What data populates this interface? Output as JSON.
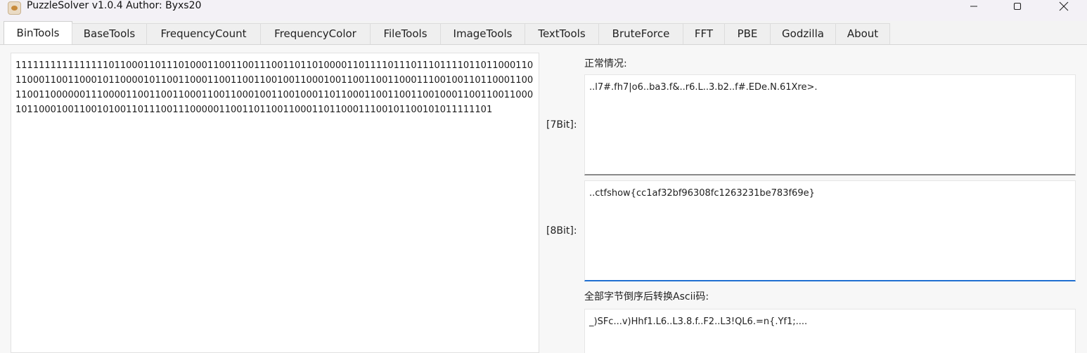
{
  "window": {
    "title": "PuzzleSolver v1.0.4  Author:  Byxs20",
    "controls": [
      "minimize-icon",
      "maximize-icon",
      "close-icon"
    ]
  },
  "tabs": [
    {
      "label": "BinTools",
      "active": true
    },
    {
      "label": "BaseTools"
    },
    {
      "label": "FrequencyCount"
    },
    {
      "label": "FrequencyColor"
    },
    {
      "label": "FileTools"
    },
    {
      "label": "ImageTools"
    },
    {
      "label": "TextTools"
    },
    {
      "label": "BruteForce"
    },
    {
      "label": "FFT"
    },
    {
      "label": "PBE"
    },
    {
      "label": "Godzilla"
    },
    {
      "label": "About"
    }
  ],
  "bin_input": {
    "value": "1111111111111111011000110111010001100110011100110110100001101111011101110111101101100011011000110011000101100001011001100011001100110010011000100110011001100011100100110110001100110011000000111000011001100110001100110001001100100011011000110011001100100011001100110001011000100110010100110111001110000011001101100110001101100011100101100101011111101"
  },
  "outputs": {
    "normal_label": "正常情况:",
    "bit7_label": "[7Bit]:",
    "bit7_value": "..l7#.fh7|o6..ba3.f&..r6.L..3.b2..f#.EDe.N.61Xre>.",
    "bit8_label": "[8Bit]:",
    "bit8_value": "..ctfshow{cc1af32bf96308fc1263231be783f69e}",
    "reverse_label": "全部字节倒序后转换Ascii码:",
    "reverse_value": "_)SFc...v)Hhf1.L6..L3.8.f..F2..L3!QL6.=n{.Yf1;...."
  }
}
